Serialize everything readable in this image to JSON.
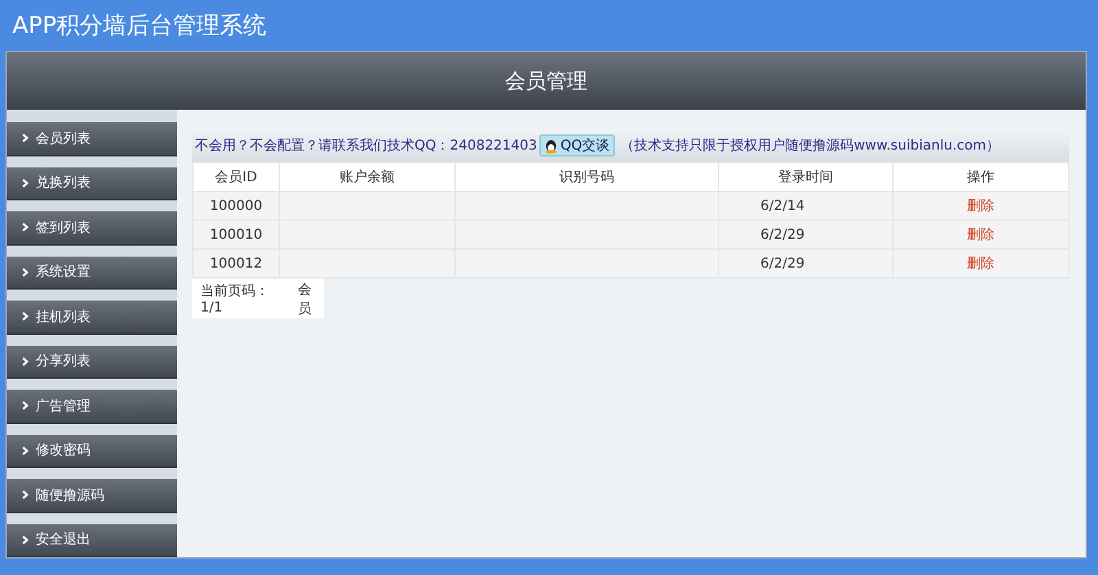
{
  "app_title": "APP积分墙后台管理系统",
  "page_title": "会员管理",
  "sidebar": {
    "items": [
      {
        "label": "会员列表"
      },
      {
        "label": "兑换列表"
      },
      {
        "label": "签到列表"
      },
      {
        "label": "系统设置"
      },
      {
        "label": "挂机列表"
      },
      {
        "label": "分享列表"
      },
      {
        "label": "广告管理"
      },
      {
        "label": "修改密码"
      },
      {
        "label": "随便撸源码"
      },
      {
        "label": "安全退出"
      }
    ]
  },
  "notice": {
    "text": "不会用？不会配置？请联系我们技术QQ：2408221403",
    "qq_button": "QQ交谈",
    "note": "（技术支持只限于授权用户随便撸源码www.suibianlu.com）"
  },
  "table": {
    "columns": [
      "会员ID",
      "账户余额",
      "识别号码",
      "登录时间",
      "操作"
    ],
    "rows": [
      {
        "id": "100000",
        "login_time": "6/2/14",
        "action": "删除"
      },
      {
        "id": "100010",
        "login_time": "6/2/29",
        "action": "删除"
      },
      {
        "id": "100012",
        "login_time": "6/2/29",
        "action": "删除"
      }
    ]
  },
  "pager": {
    "page": "当前页码：1/1",
    "count": "会员"
  }
}
